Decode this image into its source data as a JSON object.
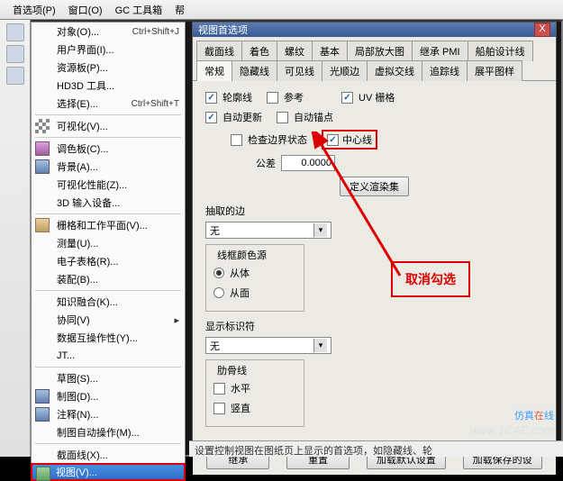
{
  "toolbar": {
    "items": [
      "首选项(P)",
      "窗口(O)",
      "GC 工具箱",
      "帮"
    ]
  },
  "menu": {
    "items": [
      {
        "label": "对象(O)...",
        "shortcut": "Ctrl+Shift+J"
      },
      {
        "label": "用户界面(I)...",
        "shortcut": ""
      },
      {
        "label": "资源板(P)...",
        "shortcut": ""
      },
      {
        "label": "HD3D 工具...",
        "shortcut": ""
      },
      {
        "label": "选择(E)...",
        "shortcut": "Ctrl+Shift+T"
      },
      {
        "sep": true
      },
      {
        "label": "可视化(V)...",
        "shortcut": "",
        "icon": "ico-checker"
      },
      {
        "sep": true
      },
      {
        "label": "调色板(C)...",
        "shortcut": "",
        "icon": "ico-pal"
      },
      {
        "label": "背景(A)...",
        "shortcut": "",
        "icon": "ico-box"
      },
      {
        "label": "可视化性能(Z)...",
        "shortcut": ""
      },
      {
        "label": "3D 输入设备...",
        "shortcut": ""
      },
      {
        "sep": true
      },
      {
        "label": "栅格和工作平面(V)...",
        "shortcut": "",
        "icon": "ico-grid"
      },
      {
        "label": "测量(U)...",
        "shortcut": ""
      },
      {
        "label": "电子表格(R)...",
        "shortcut": ""
      },
      {
        "label": "装配(B)...",
        "shortcut": ""
      },
      {
        "sep": true
      },
      {
        "label": "知识融合(K)...",
        "shortcut": ""
      },
      {
        "label": "协同(V)",
        "shortcut": "",
        "arrow": true
      },
      {
        "label": "数据互操作性(Y)...",
        "shortcut": ""
      },
      {
        "label": "JT...",
        "shortcut": ""
      },
      {
        "sep": true
      },
      {
        "label": "草图(S)...",
        "shortcut": ""
      },
      {
        "label": "制图(D)...",
        "shortcut": "",
        "icon": "ico-box"
      },
      {
        "label": "注释(N)...",
        "shortcut": "",
        "icon": "ico-box"
      },
      {
        "label": "制图自动操作(M)...",
        "shortcut": ""
      },
      {
        "sep": true
      },
      {
        "label": "截面线(X)...",
        "shortcut": ""
      },
      {
        "label": "视图(V)...",
        "shortcut": "",
        "icon": "ico-eye",
        "selected": true
      }
    ]
  },
  "dialog": {
    "title": "视图首选项",
    "close": "X",
    "tabs_row1": [
      "截面线",
      "着色",
      "螺纹",
      "基本",
      "局部放大图",
      "继承 PMI",
      "船舶设计线"
    ],
    "tabs_row2": [
      "常规",
      "隐藏线",
      "可见线",
      "光顺边",
      "虚拟交线",
      "追踪线",
      "展平图样"
    ],
    "active_tab": "常规",
    "checks": {
      "outline": "轮廓线",
      "outline_on": true,
      "ref": "参考",
      "ref_on": false,
      "uvgrid": "UV 栅格",
      "uvgrid_on": true,
      "autoupdate": "自动更新",
      "autoupdate_on": true,
      "autoanchor": "自动锚点",
      "autoanchor_on": false,
      "boundary": "检查边界状态",
      "boundary_on": false,
      "centerline": "中心线",
      "centerline_on": true
    },
    "tolerance_label": "公差",
    "tolerance_value": "0.0000",
    "define_render": "定义渲染集",
    "extract_edge": "抽取的边",
    "extract_select": "无",
    "wireframe_group": "线框颜色源",
    "from_body": "从体",
    "from_body_on": true,
    "from_face": "从面",
    "from_face_on": false,
    "display_id": "显示标识符",
    "display_id_select": "无",
    "rib_group": "肋骨线",
    "horiz": "水平",
    "horiz_on": false,
    "vert": "竖直",
    "vert_on": false,
    "annotation": "取消勾选",
    "foot": {
      "inherit": "继承",
      "reset": "重置",
      "load_default": "加载默认设置",
      "load_saved": "加载保存的设"
    }
  },
  "status": "设置控制视图在图纸页上显示的首选项，如隐藏线、轮",
  "watermark": {
    "text_a": "仿真",
    "text_b": "在",
    "text_c": "线",
    "url": "www.1CAE.com"
  }
}
